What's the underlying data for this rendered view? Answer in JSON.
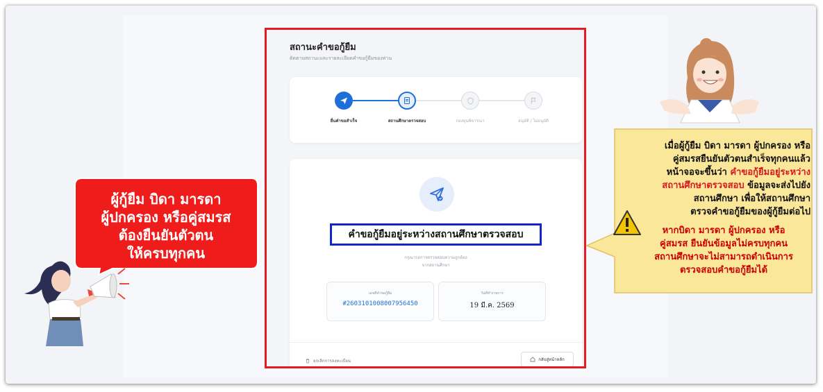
{
  "screen": {
    "title": "สถานะคำขอกู้ยืม",
    "subtitle": "ติดตามสถานะและรายละเอียดคำขอกู้ยืมของท่าน",
    "steps": [
      {
        "label": "ยื่นคำขอสำเร็จ",
        "state": "done",
        "icon": "send-icon"
      },
      {
        "label": "สถานศึกษาตรวจสอบ",
        "state": "current",
        "icon": "document-icon"
      },
      {
        "label": "กองทุนพิจารณา",
        "state": "pending",
        "icon": "shield-icon"
      },
      {
        "label": "อนุมัติ / ไม่อนุมัติ",
        "state": "pending",
        "icon": "flag-icon"
      }
    ],
    "status_text": "คำขอกู้ยืมอยู่ระหว่างสถานศึกษาตรวจสอบ",
    "hint_line1": "กรุณารอการตรวจสอบความถูกต้อง",
    "hint_line2": "จากสถานศึกษา",
    "request_no_label": "เลขที่คำขอกู้ยืม",
    "request_no": "#2603101008007956450",
    "submit_date_label": "วันที่ทำรายการ",
    "submit_date": "19 มี.ค. 2569",
    "cancel_label": "ยกเลิกการลงทะเบียน",
    "home_label": "กลับสู่หน้าหลัก"
  },
  "left_callout": {
    "line1": "ผู้กู้ยืม บิดา มารดา",
    "line2": "ผู้ปกครอง หรือคู่สมรส",
    "line3": "ต้องยืนยันตัวตน",
    "line4": "ให้ครบทุกคน"
  },
  "right_callout": {
    "line1": "เมื่อผู้กู้ยืม บิดา มารดา ผู้ปกครอง หรือ",
    "line2": "คู่สมรสยืนยันตัวตนสำเร็จทุกคนแล้ว",
    "line3": "หน้าจอจะขึ้นว่า",
    "line3_red": "คำขอกู้ยืมอยู่ระหว่าง",
    "line4_red": "สถานศึกษาตรวจสอบ",
    "line4": "ข้อมูลจะส่งไปยัง",
    "line5": "สถานศึกษา เพื่อให้สถานศึกษา",
    "line6": "ตรวจคำขอกู้ยืมของผู้กู้ยืมต่อไป",
    "warn1": "หากบิดา มารดา ผู้ปกครอง หรือ",
    "warn2": "คู่สมรส ยืนยันข้อมูลไม่ครบทุกคน",
    "warn3": "สถานศึกษาจะไม่สามารถดำเนินการ",
    "warn4": "ตรวจสอบคำขอกู้ยืมได้"
  },
  "colors": {
    "primary": "#1f6fd8",
    "highlight_red": "#e11d23",
    "highlight_blue": "#1324c8",
    "callout_yellow": "#fbe79a"
  }
}
